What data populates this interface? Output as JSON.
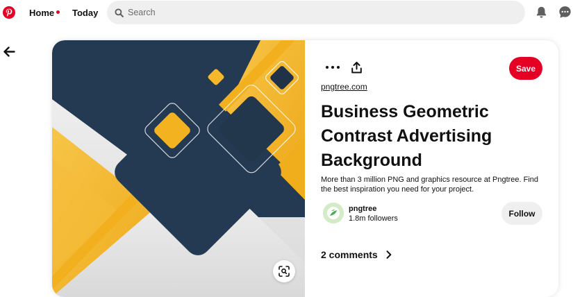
{
  "nav": {
    "home_label": "Home",
    "today_label": "Today"
  },
  "search": {
    "placeholder": "Search",
    "value": ""
  },
  "icons": {
    "logo": "pinterest-logo",
    "search": "search-icon",
    "notifications": "bell-icon",
    "messages": "chat-icon",
    "back": "arrow-left-icon",
    "more": "more-icon",
    "share": "share-icon",
    "visual_search": "visual-search-icon",
    "comments_expand": "chevron-right-icon"
  },
  "colors": {
    "brand": "#e60023",
    "navy": "#243a52",
    "yellow": "#f2b01e",
    "neutral_button": "#efefef"
  },
  "pin": {
    "source": "pngtree.com",
    "title": "Business Geometric Contrast Advertising Background",
    "description": "More than 3 million PNG and graphics resource at Pngtree. Find the best inspiration you need for your project.",
    "save_label": "Save",
    "comments_label": "2 comments"
  },
  "creator": {
    "name": "pngtree",
    "followers": "1.8m followers",
    "follow_label": "Follow"
  }
}
